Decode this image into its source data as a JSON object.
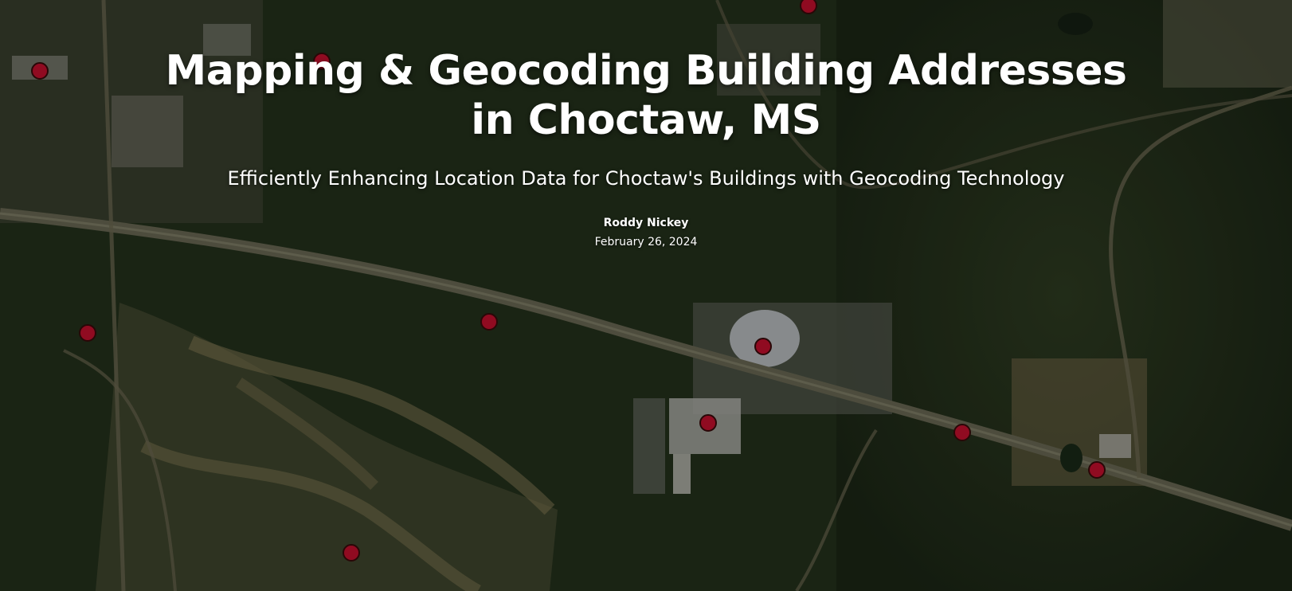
{
  "story": {
    "title": "Mapping & Geocoding Building Addresses in Choctaw, MS",
    "subtitle": "Efficiently Enhancing Location Data for Choctaw's Buildings with Geocoding Technology",
    "author": "Roddy Nickey",
    "date": "February 26, 2024"
  },
  "map": {
    "basemap": "satellite-imagery",
    "marker_color": "#c8102e",
    "marker_stroke": "#3a0a0a",
    "marker_icon": "building-location-marker"
  }
}
